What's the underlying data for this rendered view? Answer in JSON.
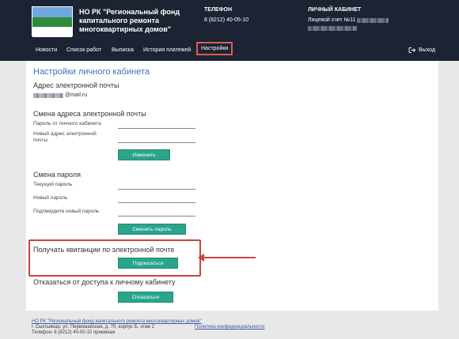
{
  "header": {
    "org_name_line1": "НО РК \"Региональный фонд",
    "org_name_line2": "капитального ремонта",
    "org_name_line3": "многоквартирных домов\"",
    "flag_colors": [
      "#6fa8dc",
      "#2e8b3a",
      "#ffffff"
    ],
    "phone_heading": "ТЕЛЕФОН",
    "phone_value": "8 (8212) 40-05-10",
    "cabinet_heading": "ЛИЧНЫЙ КАБИНЕТ",
    "account_label": "Лицевой счет №11"
  },
  "nav": {
    "items": [
      "Новости",
      "Список работ",
      "Выписка",
      "История платежей",
      "Настройки"
    ],
    "active": "Настройки",
    "logout": "Выход"
  },
  "main": {
    "title": "Настройки личного кабинета",
    "email_section": {
      "heading": "Адрес электронной почты",
      "email_suffix": "@mail.ru"
    },
    "change_email": {
      "heading": "Смена адреса электронной почты",
      "password_label": "Пароль от личного кабинета",
      "new_email_label_line1": "Новый адрес электронной",
      "new_email_label_line2": "почты",
      "button": "Изменить"
    },
    "change_password": {
      "heading": "Смена пароля",
      "current_label": "Текущий пароль",
      "new_label": "Новый пароль",
      "confirm_label": "Подтвердите новый пароль",
      "button": "Сменить пароль"
    },
    "receipts": {
      "heading": "Получать квитанции по электронной почте",
      "button": "Подписаться"
    },
    "refuse": {
      "heading": "Отказаться от доступа к личному кабинету",
      "button": "Отказаться"
    }
  },
  "footer": {
    "org_link": "НО РК \"Региональный фонд капитального ремонта многоквартирных домов\"",
    "address": "г. Сыктывкар, ул. Первомайская, д. 70, корпус Б, этаж 2",
    "privacy_link": "Политика конфиденциальности",
    "phone": "Телефон: 8 (8212) 40-00-10 приемная"
  },
  "colors": {
    "accent": "#2aa58c",
    "header_bg": "#1c2433",
    "highlight": "#c9443d",
    "title": "#3a72b8"
  }
}
